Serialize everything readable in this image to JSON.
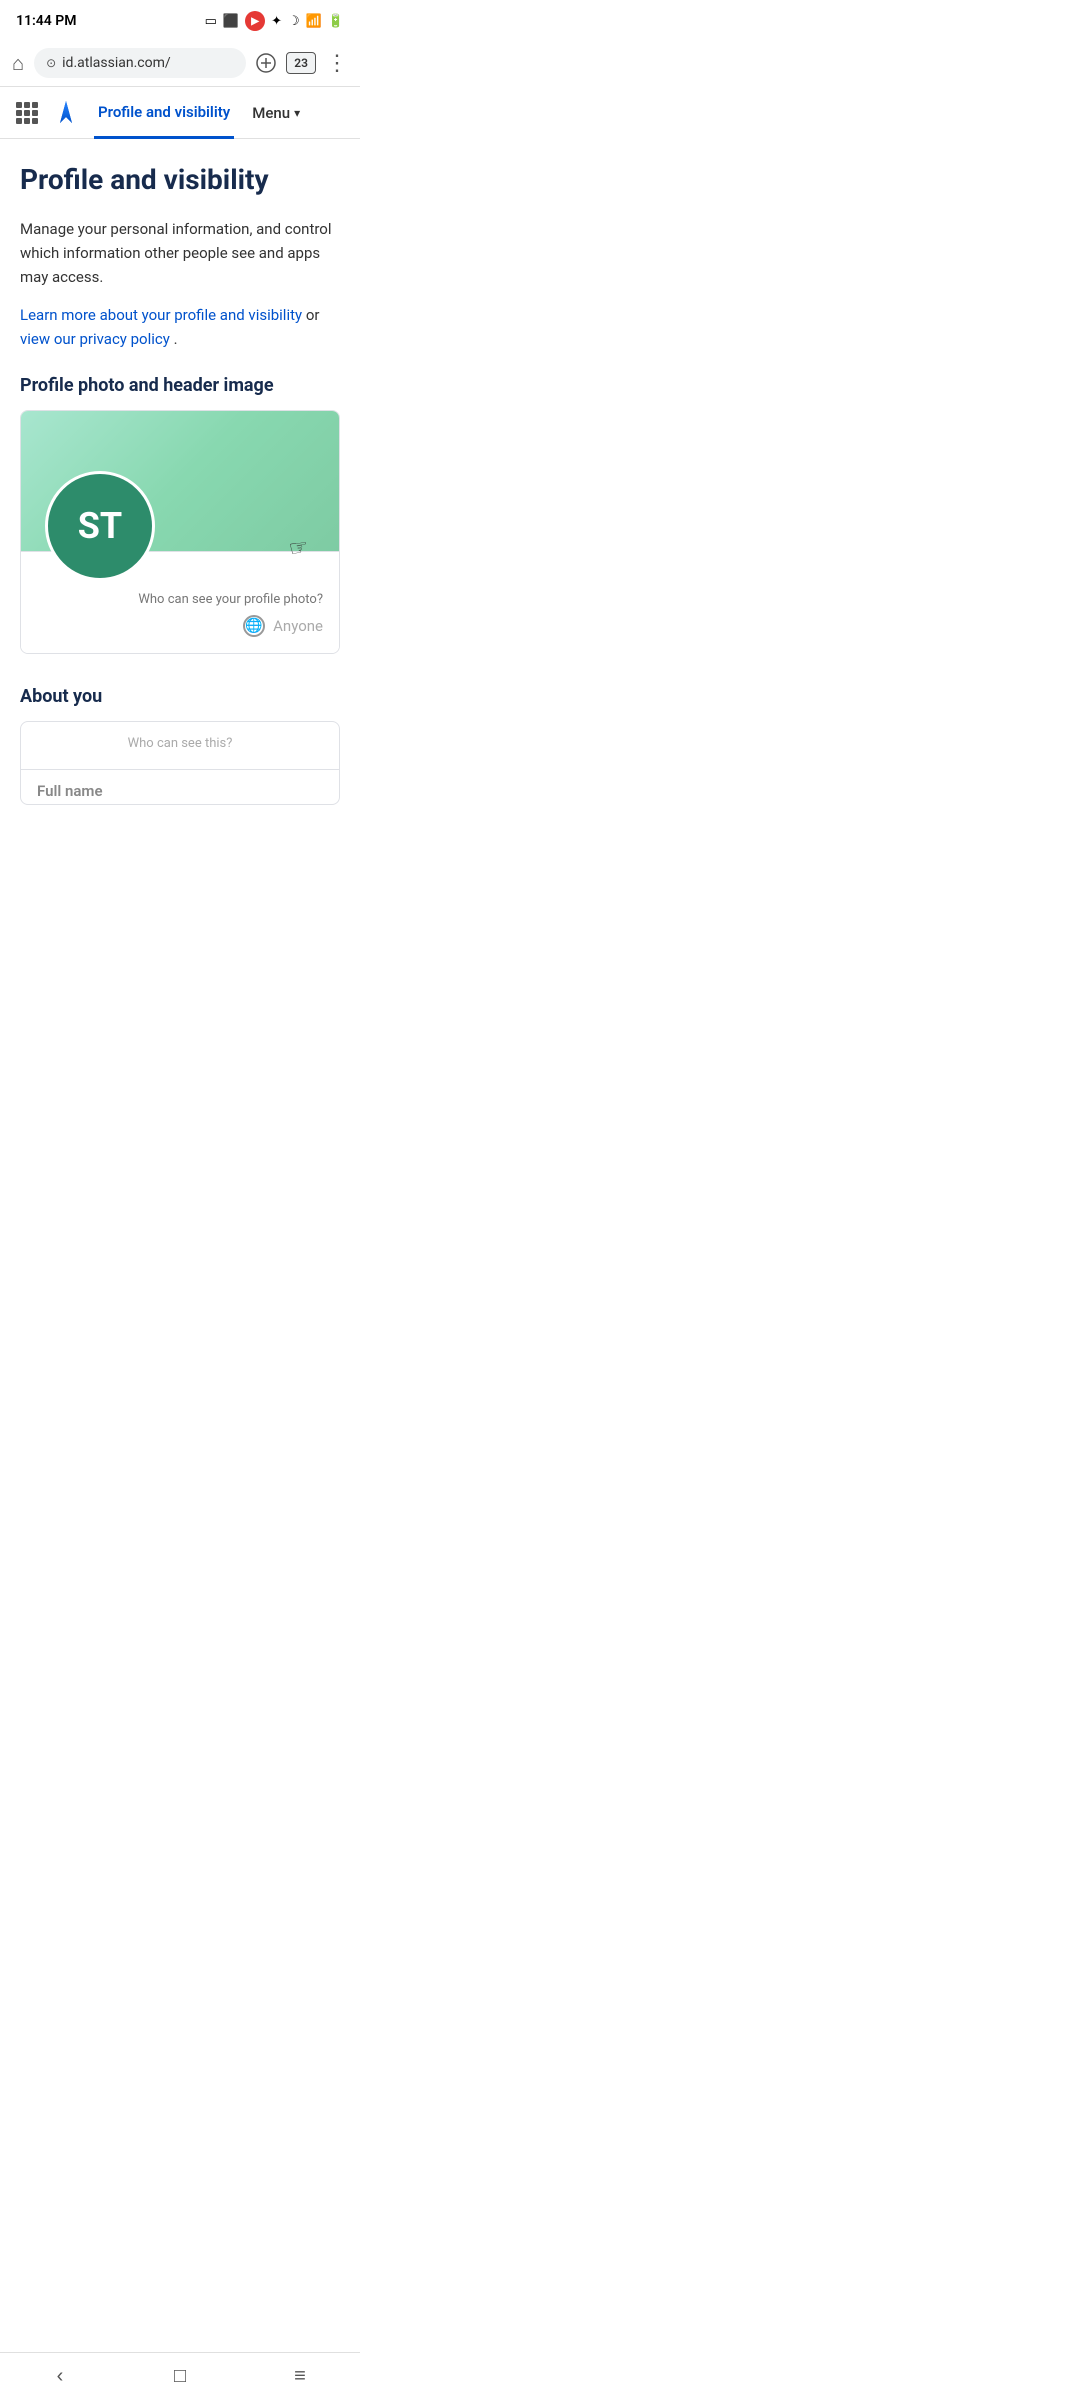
{
  "statusBar": {
    "time": "11:44 PM",
    "icons": [
      "video-call",
      "camera",
      "recording",
      "bluetooth",
      "moon",
      "wifi",
      "battery"
    ]
  },
  "browserBar": {
    "url": "id.atlassian.com/",
    "tabCount": "23",
    "homeLabel": "⌂",
    "addLabel": "+",
    "moreLabel": "⋮"
  },
  "navBar": {
    "activeTab": "Profile and visibility",
    "menuLabel": "Menu"
  },
  "page": {
    "title": "Profile and visibility",
    "description": "Manage your personal information, and control which information other people see and apps may access.",
    "learnMoreLink": "Learn more about your profile and visibility",
    "privacyLink": "view our privacy policy",
    "linkConnector": " or ",
    "linkEnd": "."
  },
  "profilePhotoSection": {
    "sectionTitle": "Profile photo and header image",
    "avatarInitials": "ST",
    "visibilityQuestion": "Who can see your profile photo?",
    "visibilityValue": "Anyone"
  },
  "aboutSection": {
    "sectionTitle": "About you",
    "whoCanSeeLabel": "Who can see this?",
    "fullNameLabel": "Full name"
  },
  "bottomNav": {
    "backLabel": "‹",
    "homeLabel": "□",
    "menuLabel": "≡"
  }
}
